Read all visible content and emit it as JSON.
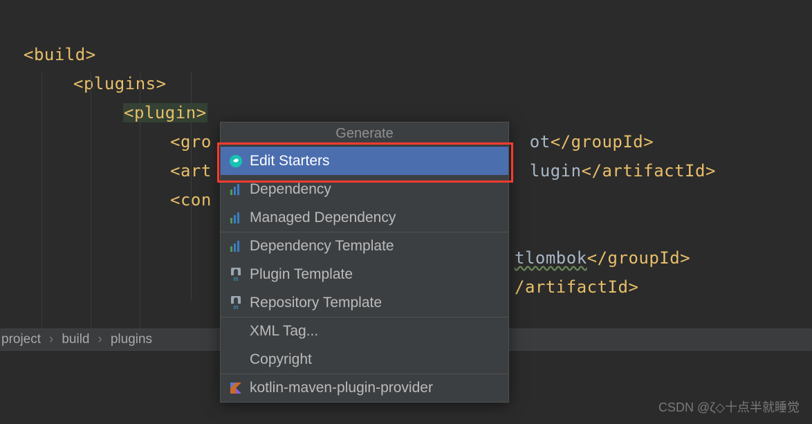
{
  "code": {
    "l1": "<build>",
    "l2": "<plugins>",
    "l3": "<plugin>",
    "l4a_open": "<gro",
    "l4a_tail_txt": "ot",
    "l4a_tail_close": "</groupId>",
    "l5a_open": "<art",
    "l5a_tail_txt": "lugin",
    "l5a_tail_close": "</artifactId>",
    "l6_open": "<con",
    "l8_tail_txt": "tlombok",
    "l8_tail_close": "</groupId>",
    "l9_tail_close": "/artifactId>"
  },
  "breadcrumb": {
    "items": [
      "project",
      "build",
      "plugins"
    ]
  },
  "popup": {
    "title": "Generate",
    "items": [
      {
        "label": "Edit Starters",
        "icon": "spring"
      },
      {
        "label": "Dependency",
        "icon": "bars"
      },
      {
        "label": "Managed Dependency",
        "icon": "bars"
      },
      {
        "label": "Dependency Template",
        "icon": "bars",
        "sep": true
      },
      {
        "label": "Plugin Template",
        "icon": "m"
      },
      {
        "label": "Repository Template",
        "icon": "m"
      },
      {
        "label": "XML Tag...",
        "icon": "",
        "sep": true
      },
      {
        "label": "Copyright",
        "icon": ""
      },
      {
        "label": "kotlin-maven-plugin-provider",
        "icon": "kotlin",
        "sep": true
      }
    ],
    "selected_index": 0
  },
  "watermark": "CSDN @ζ◇十点半就睡觉"
}
